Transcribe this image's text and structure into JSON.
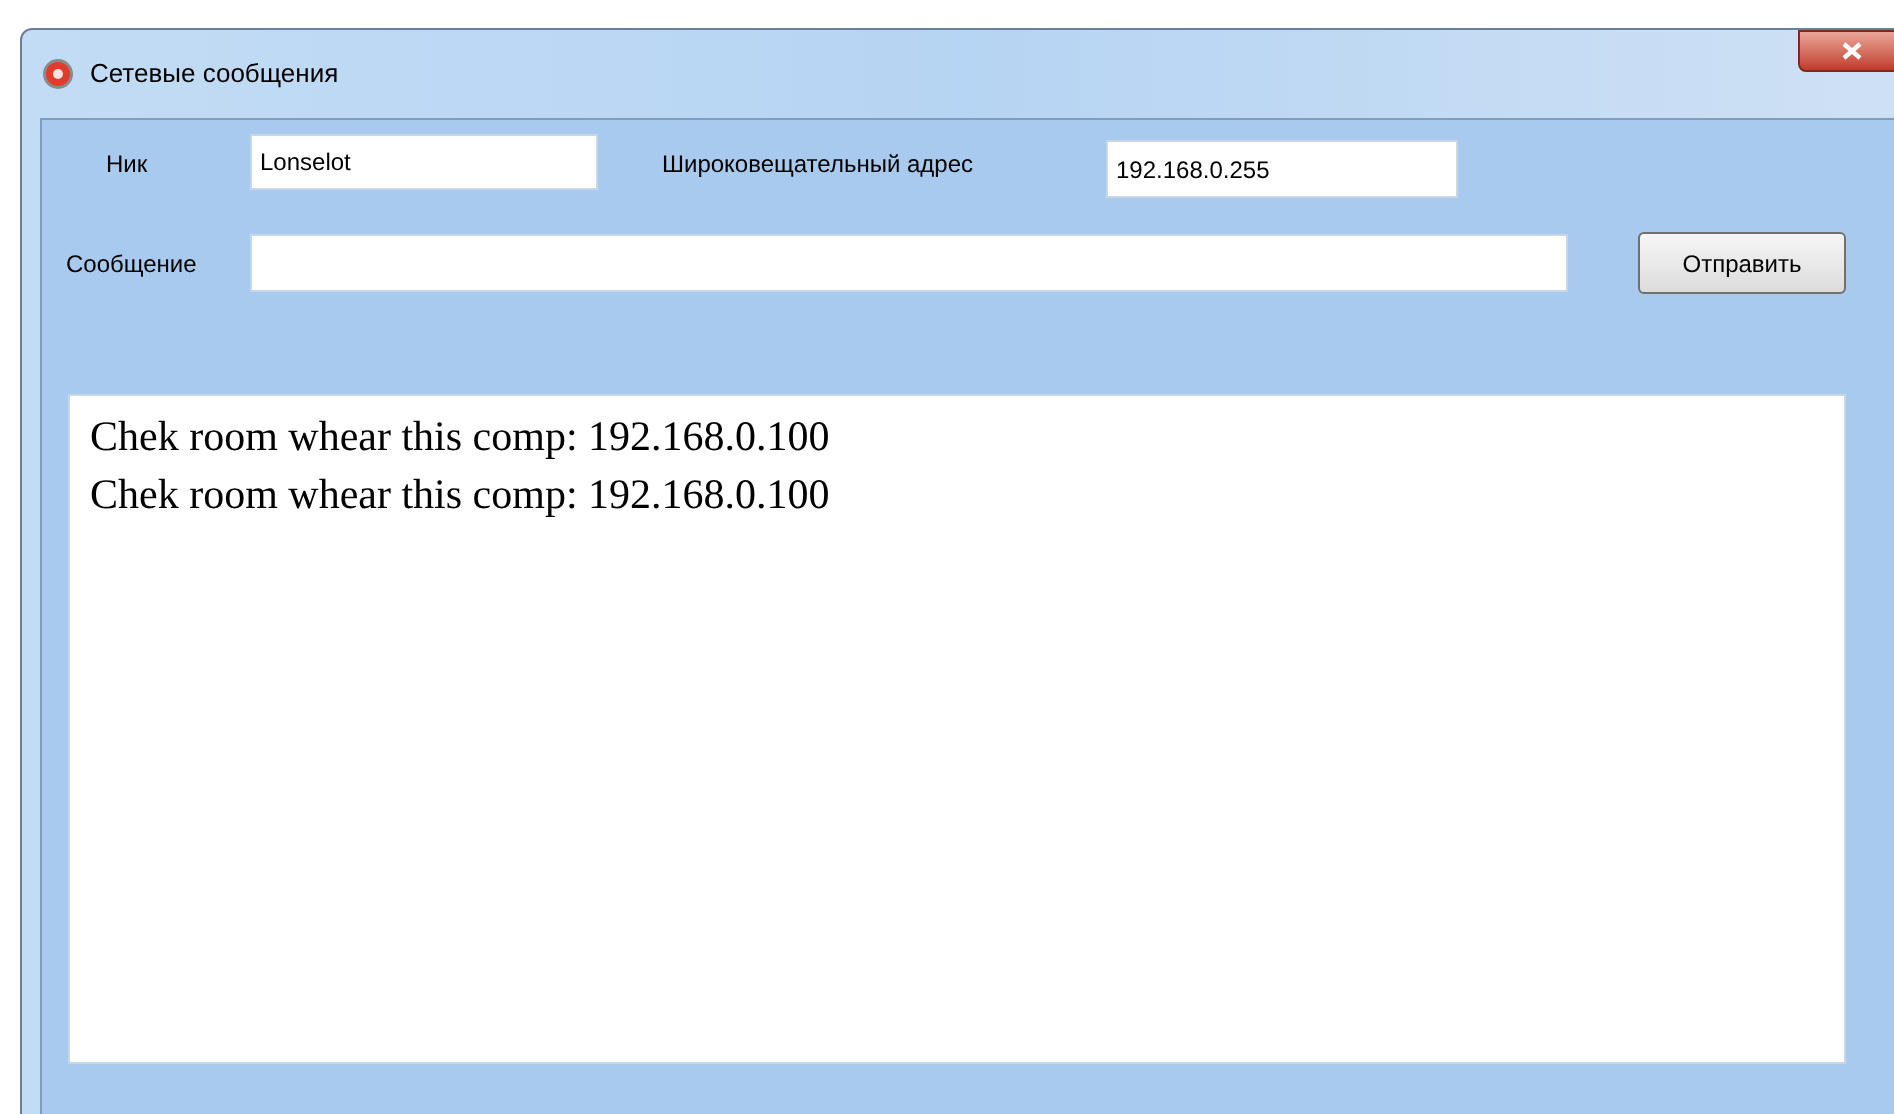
{
  "window": {
    "title": "Сетевые сообщения"
  },
  "nick": {
    "label": "Ник",
    "value": "Lonselot"
  },
  "broadcast": {
    "label": "Широковещательный адрес",
    "value": "192.168.0.255"
  },
  "message": {
    "label": "Сообщение",
    "send_button": "Отправить"
  },
  "log": [
    "Chek room whear this comp: 192.168.0.100",
    "Chek room whear this comp: 192.168.0.100"
  ]
}
